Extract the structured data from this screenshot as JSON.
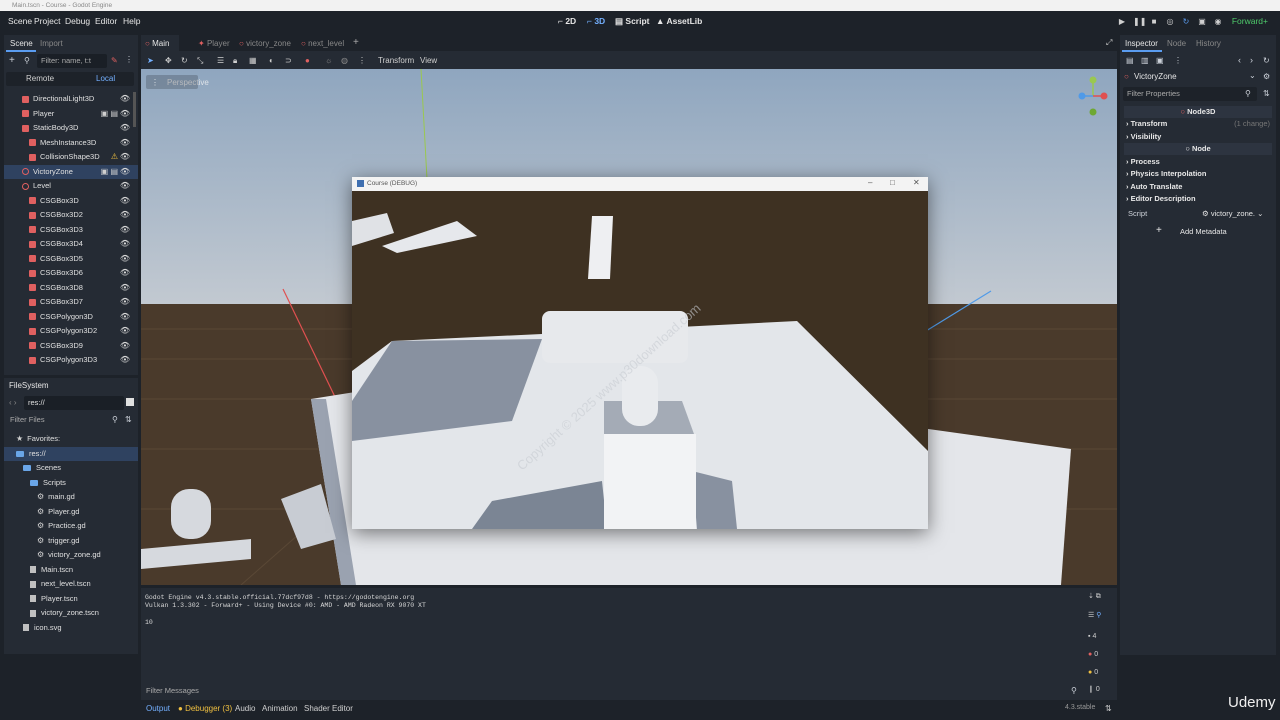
{
  "window_title": "Main.tscn - Course - Godot Engine",
  "menu": [
    "Scene",
    "Project",
    "Debug",
    "Editor",
    "Help"
  ],
  "workspaces": [
    {
      "label": "2D",
      "active": false
    },
    {
      "label": "3D",
      "active": true
    },
    {
      "label": "Script",
      "active": false
    },
    {
      "label": "AssetLib",
      "active": false
    }
  ],
  "renderer": "Forward+",
  "scene_dock": {
    "tabs": [
      "Scene",
      "Import"
    ],
    "filter_placeholder": "Filter: name, t:t",
    "remote_label": "Remote",
    "local_label": "Local",
    "nodes": [
      {
        "label": "DirectionalLight3D",
        "indent": 1,
        "icon": "light-icon",
        "selected": false
      },
      {
        "label": "Player",
        "indent": 1,
        "icon": "player-icon",
        "selected": false
      },
      {
        "label": "StaticBody3D",
        "indent": 1,
        "icon": "static-body-icon",
        "selected": false
      },
      {
        "label": "MeshInstance3D",
        "indent": 2,
        "icon": "mesh-icon",
        "selected": false
      },
      {
        "label": "CollisionShape3D",
        "indent": 2,
        "icon": "collision-icon",
        "selected": false
      },
      {
        "label": "VictoryZone",
        "indent": 1,
        "icon": "area-icon",
        "selected": true
      },
      {
        "label": "Level",
        "indent": 1,
        "icon": "node3d-icon",
        "selected": false
      },
      {
        "label": "CSGBox3D",
        "indent": 2,
        "icon": "csg-icon",
        "selected": false
      },
      {
        "label": "CSGBox3D2",
        "indent": 2,
        "icon": "csg-icon",
        "selected": false
      },
      {
        "label": "CSGBox3D3",
        "indent": 2,
        "icon": "csg-icon",
        "selected": false
      },
      {
        "label": "CSGBox3D4",
        "indent": 2,
        "icon": "csg-icon",
        "selected": false
      },
      {
        "label": "CSGBox3D5",
        "indent": 2,
        "icon": "csg-icon",
        "selected": false
      },
      {
        "label": "CSGBox3D6",
        "indent": 2,
        "icon": "csg-icon",
        "selected": false
      },
      {
        "label": "CSGBox3D8",
        "indent": 2,
        "icon": "csg-icon",
        "selected": false
      },
      {
        "label": "CSGBox3D7",
        "indent": 2,
        "icon": "csg-icon",
        "selected": false
      },
      {
        "label": "CSGPolygon3D",
        "indent": 2,
        "icon": "csg-icon",
        "selected": false
      },
      {
        "label": "CSGPolygon3D2",
        "indent": 2,
        "icon": "csg-icon",
        "selected": false
      },
      {
        "label": "CSGBox3D9",
        "indent": 2,
        "icon": "csg-icon",
        "selected": false
      },
      {
        "label": "CSGPolygon3D3",
        "indent": 2,
        "icon": "csg-icon",
        "selected": false
      }
    ]
  },
  "filesystem": {
    "title": "FileSystem",
    "path": "res://",
    "filter_placeholder": "Filter Files",
    "items": [
      {
        "label": "Favorites:",
        "indent": 0,
        "type": "star",
        "selected": false
      },
      {
        "label": "res://",
        "indent": 0,
        "type": "folder",
        "selected": true
      },
      {
        "label": "Scenes",
        "indent": 1,
        "type": "folder",
        "selected": false
      },
      {
        "label": "Scripts",
        "indent": 2,
        "type": "folder",
        "selected": false
      },
      {
        "label": "main.gd",
        "indent": 3,
        "type": "gear",
        "selected": false
      },
      {
        "label": "Player.gd",
        "indent": 3,
        "type": "gear",
        "selected": false
      },
      {
        "label": "Practice.gd",
        "indent": 3,
        "type": "gear",
        "selected": false
      },
      {
        "label": "trigger.gd",
        "indent": 3,
        "type": "gear",
        "selected": false
      },
      {
        "label": "victory_zone.gd",
        "indent": 3,
        "type": "gear",
        "selected": false
      },
      {
        "label": "Main.tscn",
        "indent": 2,
        "type": "file",
        "selected": false
      },
      {
        "label": "next_level.tscn",
        "indent": 2,
        "type": "file",
        "selected": false
      },
      {
        "label": "Player.tscn",
        "indent": 2,
        "type": "file",
        "selected": false
      },
      {
        "label": "victory_zone.tscn",
        "indent": 2,
        "type": "file",
        "selected": false
      },
      {
        "label": "icon.svg",
        "indent": 1,
        "type": "file",
        "selected": false
      }
    ]
  },
  "scene_tabs": [
    {
      "label": "Main",
      "active": true
    },
    {
      "label": "Player",
      "active": false
    },
    {
      "label": "victory_zone",
      "active": false
    },
    {
      "label": "next_level",
      "active": false
    }
  ],
  "viewport_toolbar": {
    "transform_label": "Transform",
    "view_label": "View"
  },
  "viewport": {
    "perspective_label": "Perspective"
  },
  "debug_window": {
    "title": "Course (DEBUG)",
    "watermark": "Copyright © 2025 www.p30download.com"
  },
  "inspector": {
    "tabs": [
      "Inspector",
      "Node",
      "History"
    ],
    "object_name": "VictoryZone",
    "filter_placeholder": "Filter Properties",
    "class_node3d": "Node3D",
    "transform": "Transform",
    "transform_changes": "(1 change)",
    "visibility": "Visibility",
    "class_node": "Node",
    "process": "Process",
    "physics_interp": "Physics Interpolation",
    "auto_translate": "Auto Translate",
    "editor_desc": "Editor Description",
    "script_label": "Script",
    "script_value": "victory_zone.",
    "add_metadata": "Add Metadata"
  },
  "console": {
    "lines": [
      "Godot Engine v4.3.stable.official.77dcf97d8 - https://godotengine.org",
      "Vulkan 1.3.302 - Forward+ - Using Device #0: AMD - AMD Radeon RX 9070 XT",
      "",
      "10"
    ],
    "filter_placeholder": "Filter Messages",
    "counts": {
      "messages": "4",
      "errors": "0",
      "warnings": "0",
      "info": "0"
    }
  },
  "bottom_tabs": [
    "Output",
    "Debugger (3)",
    "Audio",
    "Animation",
    "Shader Editor"
  ],
  "version": "4.3.stable",
  "brand": "Udemy",
  "colors": {
    "accent": "#5a9cf0",
    "renderer": "#4eca6a",
    "error": "#e06060",
    "warning": "#f0c040"
  }
}
